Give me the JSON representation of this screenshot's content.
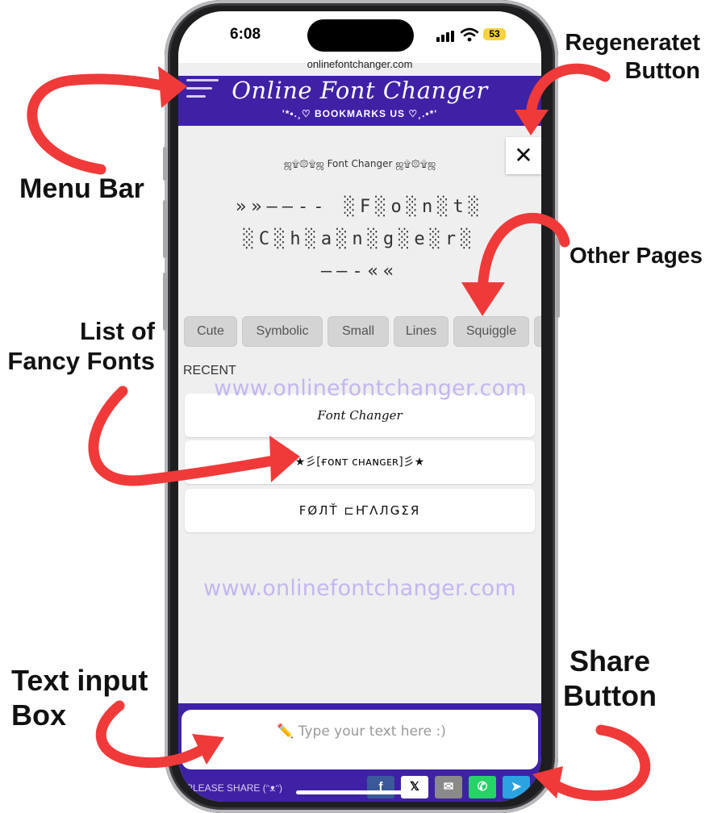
{
  "colors": {
    "brand_purple": "#3f21a6",
    "arrow_red": "#f03a3a",
    "watermark": "#c3b4ef"
  },
  "status_bar": {
    "time": "6:08",
    "battery": "53"
  },
  "browser": {
    "url": "onlinefontchanger.com"
  },
  "header": {
    "logo_title": "Online Font Changer",
    "logo_subtitle": "'*•.¸♡ BOOKMARKS US ♡¸.•*'",
    "menu_icon": "hamburger-icon"
  },
  "regenerate": {
    "icon": "close-x-icon",
    "label": "✕"
  },
  "preview": {
    "small_title": "ஜ۩۞۩ஜ Font Changer ஜ۩۞۩ஜ",
    "line1": "»»——-- ░F░o░n░t░",
    "line2": "░C░h░a░n░g░e░r░",
    "line3": "——-««"
  },
  "tabs": [
    "Cute",
    "Symbolic",
    "Small",
    "Lines",
    "Squiggle"
  ],
  "recent": {
    "label": "RECENT",
    "items": [
      "𝐹𝑜𝑛𝑡 𝐶ℎ𝑎𝑛𝑔𝑒𝑟",
      "★彡[ғᴏɴᴛ ᴄʜᴀɴɢᴇʀ]彡★",
      "FØЛŤ ⊏ҤΛЛǤΣЯ"
    ]
  },
  "watermark": {
    "text": "www.onlinefontchanger.com"
  },
  "input": {
    "placeholder": "✏️ Type your text here :)"
  },
  "share": {
    "text": "PLEASE SHARE (ᵔᴥᵔ)",
    "buttons": [
      {
        "name": "facebook",
        "label": "f",
        "color": "#3b5998"
      },
      {
        "name": "x",
        "label": "𝕏",
        "color": "#ffffff"
      },
      {
        "name": "email",
        "label": "✉",
        "color": "#8a8a8a"
      },
      {
        "name": "whatsapp",
        "label": "✆",
        "color": "#25d366"
      },
      {
        "name": "telegram",
        "label": "➤",
        "color": "#2aa3e0"
      }
    ]
  },
  "annotations": {
    "regenerate": "Regeneratet\nButton",
    "menu_bar": "Menu Bar",
    "other_pages": "Other Pages",
    "fancy_fonts": "List of\nFancy Fonts",
    "text_input": "Text input\nBox",
    "share_button": "Share\nButton"
  }
}
